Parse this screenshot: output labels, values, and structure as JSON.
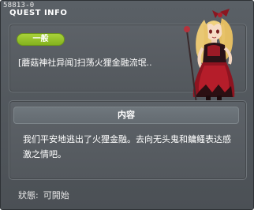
{
  "window": {
    "quest_id": "58813-0",
    "title": "QUEST INFO"
  },
  "quest": {
    "category": "一般",
    "name": "[蘑菇神社异闻]扫荡火狸金融流氓.."
  },
  "content": {
    "header": "内容",
    "text": "我们平安地逃出了火狸金融。去向无头鬼和鳙鳋表达感激之情吧。"
  },
  "status": {
    "label": "狀態:",
    "value": "可開始"
  },
  "colors": {
    "badge_green": "#8fbe24",
    "window_bg": "#54595e"
  },
  "icons": {
    "npc": "npc-character-portrait"
  }
}
